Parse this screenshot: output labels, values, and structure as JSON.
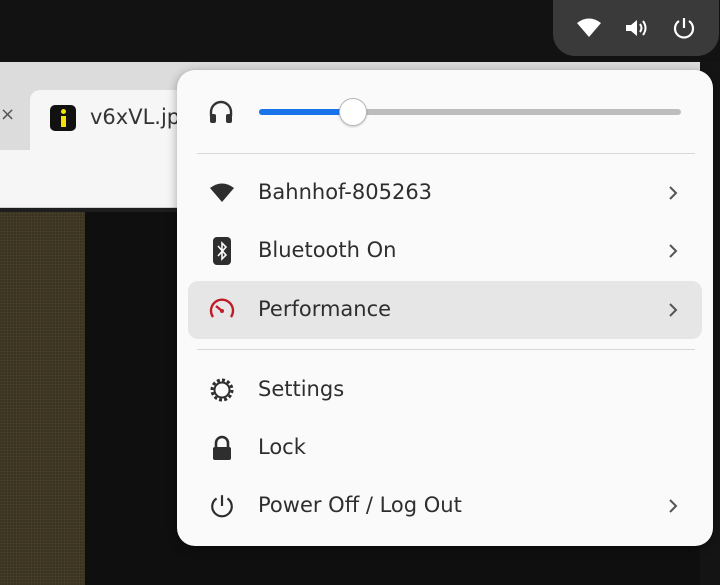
{
  "top_bar": {
    "indicators": [
      {
        "icon": "wifi-icon"
      },
      {
        "icon": "speaker-icon"
      },
      {
        "icon": "power-icon"
      }
    ]
  },
  "browser": {
    "tab": {
      "close_glyph": "×",
      "title": "v6xVL.jp"
    }
  },
  "quick_settings": {
    "volume": {
      "icon": "headphones-icon",
      "level": 0.22
    },
    "items": [
      {
        "label": "Bahnhof-805263",
        "icon": "wifi-icon",
        "has_submenu": true
      },
      {
        "label": "Bluetooth On",
        "icon": "bluetooth-icon",
        "has_submenu": true
      },
      {
        "label": "Performance",
        "icon": "performance-gauge-icon",
        "has_submenu": true,
        "highlighted": true,
        "icon_color": "#c01c28"
      },
      {
        "label": "Settings",
        "icon": "gear-icon",
        "has_submenu": false
      },
      {
        "label": "Lock",
        "icon": "lock-icon",
        "has_submenu": false
      },
      {
        "label": "Power Off / Log Out",
        "icon": "power-icon",
        "has_submenu": true
      }
    ]
  },
  "colors": {
    "accent": "#1a73e8",
    "panel_bg": "#fafafa",
    "highlight_bg": "#e6e6e6"
  }
}
